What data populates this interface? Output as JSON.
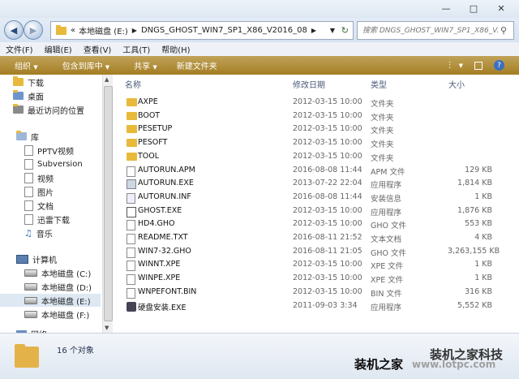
{
  "address": {
    "breadcrumb": [
      "本地磁盘 (E:)",
      "DNGS_GHOST_WIN7_SP1_X86_V2016_08"
    ]
  },
  "search": {
    "placeholder": "搜索 DNGS_GHOST_WIN7_SP1_X86_V..."
  },
  "menu": [
    "文件(F)",
    "编辑(E)",
    "查看(V)",
    "工具(T)",
    "帮助(H)"
  ],
  "toolbar": {
    "organize": "组织",
    "include": "包含到库中",
    "share": "共享",
    "new_folder": "新建文件夹"
  },
  "sidebar": {
    "favorites": [
      "下载",
      "桌面",
      "最近访问的位置"
    ],
    "libraries_header": "库",
    "libraries": [
      "PPTV视频",
      "Subversion",
      "视频",
      "图片",
      "文档",
      "迅雷下载",
      "音乐"
    ],
    "computer_header": "计算机",
    "drives": [
      "本地磁盘 (C:)",
      "本地磁盘 (D:)",
      "本地磁盘 (E:)",
      "本地磁盘 (F:)"
    ],
    "cutoff": "网络"
  },
  "columns": {
    "name": "名称",
    "date": "修改日期",
    "type": "类型",
    "size": "大小"
  },
  "files": [
    {
      "name": "AXPE",
      "date": "2012-03-15 10:00",
      "type": "文件夹",
      "size": "",
      "icon": "folder"
    },
    {
      "name": "BOOT",
      "date": "2012-03-15 10:00",
      "type": "文件夹",
      "size": "",
      "icon": "folder"
    },
    {
      "name": "PESETUP",
      "date": "2012-03-15 10:00",
      "type": "文件夹",
      "size": "",
      "icon": "folder"
    },
    {
      "name": "PESOFT",
      "date": "2012-03-15 10:00",
      "type": "文件夹",
      "size": "",
      "icon": "folder"
    },
    {
      "name": "TOOL",
      "date": "2012-03-15 10:00",
      "type": "文件夹",
      "size": "",
      "icon": "folder"
    },
    {
      "name": "AUTORUN.APM",
      "date": "2016-08-08 11:44",
      "type": "APM 文件",
      "size": "129 KB",
      "icon": "file"
    },
    {
      "name": "AUTORUN.EXE",
      "date": "2013-07-22 22:04",
      "type": "应用程序",
      "size": "1,814 KB",
      "icon": "exe"
    },
    {
      "name": "AUTORUN.INF",
      "date": "2016-08-08 11:44",
      "type": "安装信息",
      "size": "1 KB",
      "icon": "inf"
    },
    {
      "name": "GHOST.EXE",
      "date": "2012-03-15 10:00",
      "type": "应用程序",
      "size": "1,876 KB",
      "icon": "ghost"
    },
    {
      "name": "HD4.GHO",
      "date": "2012-03-15 10:00",
      "type": "GHO 文件",
      "size": "553 KB",
      "icon": "file"
    },
    {
      "name": "README.TXT",
      "date": "2016-08-11 21:52",
      "type": "文本文档",
      "size": "4 KB",
      "icon": "file"
    },
    {
      "name": "WIN7-32.GHO",
      "date": "2016-08-11 21:05",
      "type": "GHO 文件",
      "size": "3,263,155 KB",
      "icon": "file"
    },
    {
      "name": "WINNT.XPE",
      "date": "2012-03-15 10:00",
      "type": "XPE 文件",
      "size": "1 KB",
      "icon": "file"
    },
    {
      "name": "WINPE.XPE",
      "date": "2012-03-15 10:00",
      "type": "XPE 文件",
      "size": "1 KB",
      "icon": "file"
    },
    {
      "name": "WNPEFONT.BIN",
      "date": "2012-03-15 10:00",
      "type": "BIN 文件",
      "size": "316 KB",
      "icon": "file"
    },
    {
      "name": "硬盘安装.EXE",
      "date": "2011-09-03 3:34",
      "type": "应用程序",
      "size": "5,552 KB",
      "icon": "setup"
    }
  ],
  "status": {
    "count": "16 个对象"
  },
  "watermark": {
    "brand": "装机之家科技",
    "site_name": "装机之家",
    "url": "www.lotpc.com"
  },
  "colors": {
    "toolbar": "#a47d22",
    "selection": "#dde8f3",
    "folder": "#e8b93a"
  }
}
